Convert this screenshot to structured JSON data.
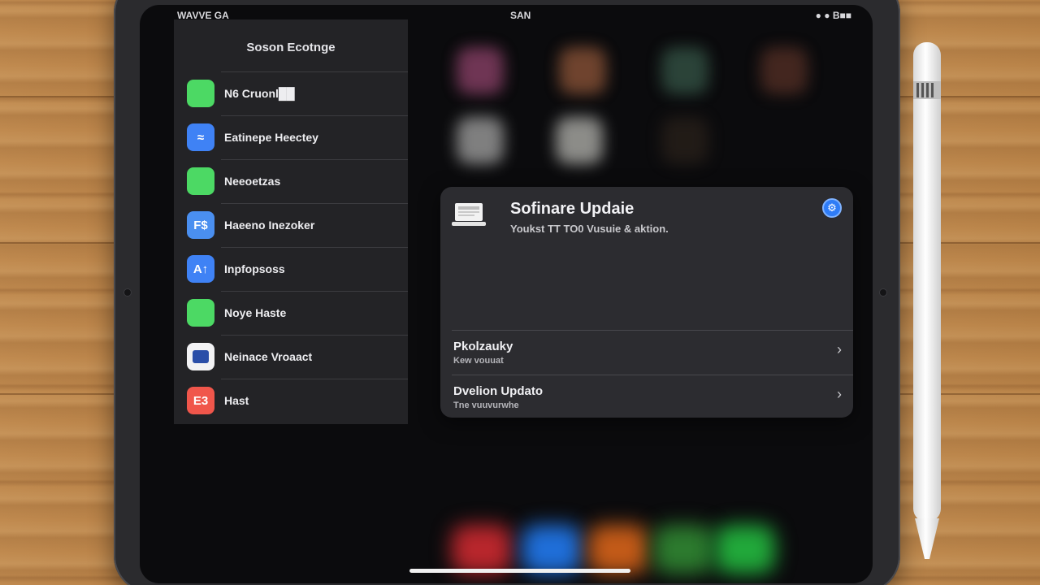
{
  "status_bar": {
    "left": "WAVVE GA",
    "center": "SAN",
    "right": "● ● B■■"
  },
  "sidebar": {
    "title": "Soson Ecotnge",
    "items": [
      {
        "label": "N6 Cruonl██",
        "icon": "green-app-icon",
        "color": "#4cd964",
        "glyph": ""
      },
      {
        "label": "Eatinepe Heectey",
        "icon": "blue-accessibility-icon",
        "color": "#3f82f5",
        "glyph": "≈"
      },
      {
        "label": "Neeoetzas",
        "icon": "green-app-icon",
        "color": "#4cd964",
        "glyph": ""
      },
      {
        "label": "Haeeno Inezoker",
        "icon": "blue-tile-icon",
        "color": "#4a8ff0",
        "glyph": "F$"
      },
      {
        "label": "Inpfopsoss",
        "icon": "blue-app-store-icon",
        "color": "#3f82f5",
        "glyph": "A↑"
      },
      {
        "label": "Noye Haste",
        "icon": "green-app-icon",
        "color": "#4cd964",
        "glyph": ""
      },
      {
        "label": "Neinace Vroaact",
        "icon": "white-square-icon",
        "color": "#f2f2f4",
        "glyph": ""
      },
      {
        "label": "Hast",
        "icon": "red-app-icon",
        "color": "#f0564b",
        "glyph": "E3"
      }
    ]
  },
  "panel": {
    "title": "Sofinare Updaie",
    "subtitle": "Youkst TT TO0 Vusuie & aktion.",
    "icon": "laptop-icon",
    "info_icon": "info-gear-icon",
    "info_glyph": "⚙",
    "rows": [
      {
        "title": "Pkolzauky",
        "subtitle": "Kew vouuat",
        "chevron": "›"
      },
      {
        "title": "Dvelion Updato",
        "subtitle": "Tne vuuvurwhe",
        "chevron": "›"
      }
    ]
  },
  "colors": {
    "screen": "#0b0b0d",
    "sidebar": "#232326",
    "panel": "#2c2c30",
    "accent": "#2f7cf6"
  }
}
